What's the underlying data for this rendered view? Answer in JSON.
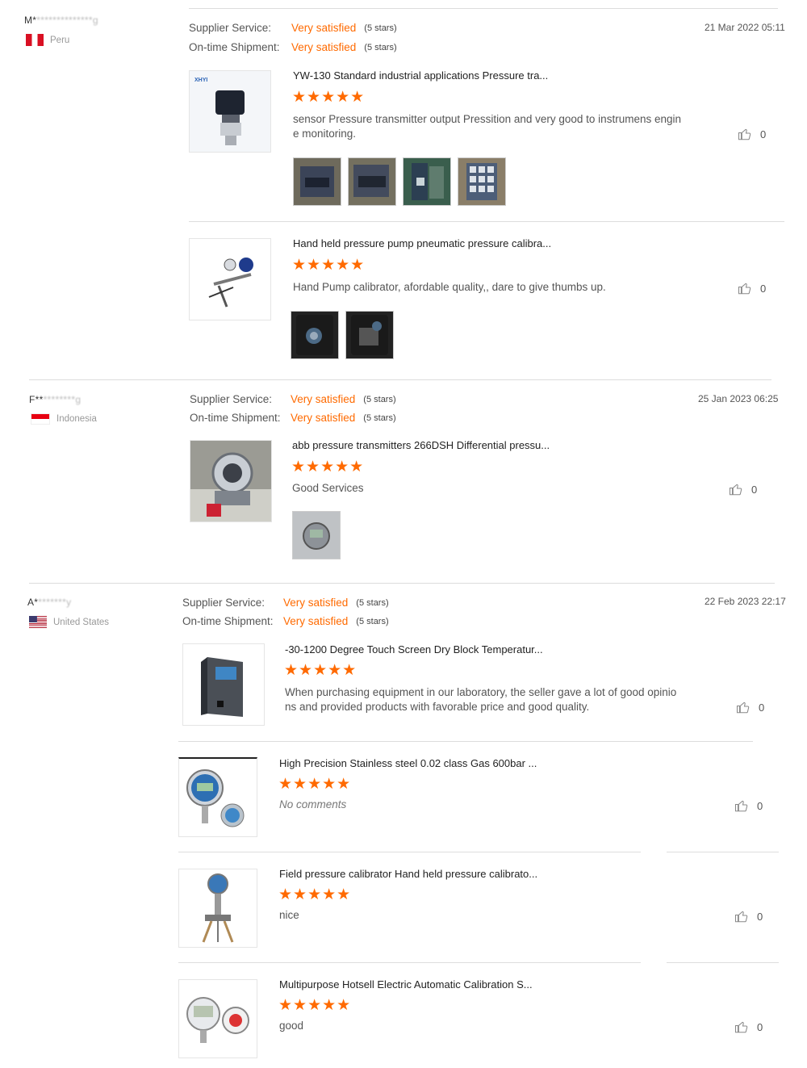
{
  "labels": {
    "supplier_service": "Supplier Service:",
    "ontime_shipment": "On-time Shipment:"
  },
  "colors": {
    "accent": "#ff6a00",
    "text": "#333333",
    "separator": "#dddddd"
  },
  "reviews": [
    {
      "buyer_initial": "M*",
      "buyer_masked": "**************g",
      "country": "Peru",
      "flag": "peru-flag",
      "date": "21 Mar 2022 05:11",
      "supplier_service": {
        "value": "Very satisfied",
        "stars_text": "(5 stars)"
      },
      "ontime_shipment": {
        "value": "Very satisfied",
        "stars_text": "(5 stars)"
      },
      "items": [
        {
          "title": "YW-130 Standard industrial applications Pressure tra...",
          "rating": 5,
          "stars": "★★★★★",
          "comment": "sensor Pressure transmitter output Pressition and very good to instrumens engin\ne monitoring.",
          "likes": "0",
          "photo_count": 4,
          "thumb_icon": "pressure-transmitter-image"
        },
        {
          "title": "Hand held pressure pump pneumatic pressure calibra...",
          "rating": 5,
          "stars": "★★★★★",
          "comment": "Hand Pump calibrator, afordable quality,, dare to give thumbs up.",
          "likes": "0",
          "photo_count": 2,
          "thumb_icon": "hand-pump-image"
        }
      ]
    },
    {
      "buyer_initial": "F**",
      "buyer_masked": "********g",
      "country": "Indonesia",
      "flag": "indonesia-flag",
      "date": "25 Jan 2023 06:25",
      "supplier_service": {
        "value": "Very satisfied",
        "stars_text": "(5 stars)"
      },
      "ontime_shipment": {
        "value": "Very satisfied",
        "stars_text": "(5 stars)"
      },
      "items": [
        {
          "title": "abb pressure transmitters 266DSH Differential pressu...",
          "rating": 5,
          "stars": "★★★★★",
          "comment": "Good Services",
          "likes": "0",
          "photo_count": 1,
          "thumb_icon": "differential-transmitter-image"
        }
      ]
    },
    {
      "buyer_initial": "A*",
      "buyer_masked": "*******y",
      "country": "United States",
      "flag": "united-states-flag",
      "date": "22 Feb 2023 22:17",
      "supplier_service": {
        "value": "Very satisfied",
        "stars_text": "(5 stars)"
      },
      "ontime_shipment": {
        "value": "Very satisfied",
        "stars_text": "(5 stars)"
      },
      "items": [
        {
          "title": "-30-1200 Degree Touch Screen Dry Block Temperatur...",
          "rating": 5,
          "stars": "★★★★★",
          "comment": "When purchasing equipment in our laboratory, the seller gave a lot of good opinio\nns and provided products with favorable price and good quality.",
          "likes": "0",
          "photo_count": 0,
          "thumb_icon": "dry-block-calibrator-image"
        },
        {
          "title": "High Precision Stainless steel 0.02 class Gas 600bar ...",
          "rating": 5,
          "stars": "★★★★★",
          "comment": "No comments",
          "likes": "0",
          "photo_count": 0,
          "thumb_icon": "digital-gauge-image"
        },
        {
          "title": "Field pressure calibrator Hand held pressure calibrato...",
          "rating": 5,
          "stars": "★★★★★",
          "comment": "nice",
          "likes": "0",
          "photo_count": 0,
          "thumb_icon": "field-calibrator-image"
        },
        {
          "title": "Multipurpose Hotsell Electric Automatic Calibration S...",
          "rating": 5,
          "stars": "★★★★★",
          "comment": "good",
          "likes": "0",
          "photo_count": 0,
          "thumb_icon": "electric-calibrator-image"
        }
      ]
    }
  ]
}
